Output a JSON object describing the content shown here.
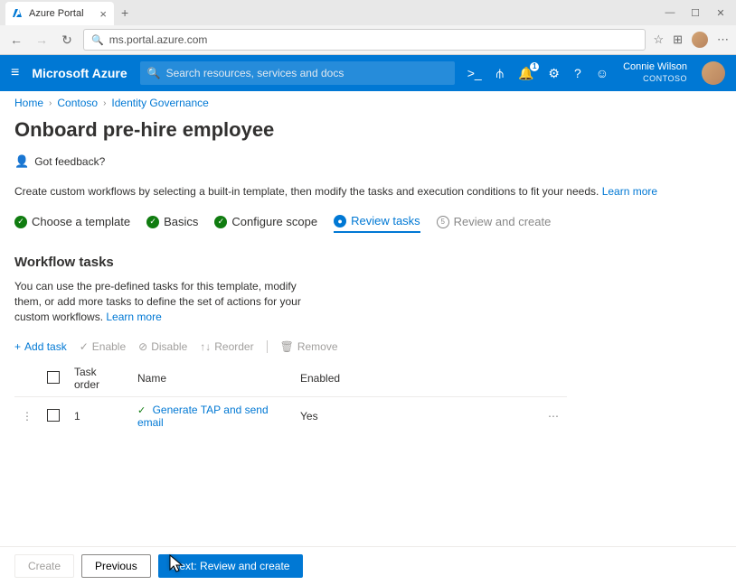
{
  "browser": {
    "tab_title": "Azure Portal",
    "url": "ms.portal.azure.com"
  },
  "azure_bar": {
    "brand": "Microsoft Azure",
    "search_placeholder": "Search resources, services and docs",
    "notif_count": "1",
    "user_name": "Connie Wilson",
    "user_org": "CONTOSO"
  },
  "breadcrumbs": [
    "Home",
    "Contoso",
    "Identity Governance"
  ],
  "page": {
    "title": "Onboard pre-hire employee",
    "feedback": "Got feedback?",
    "description": "Create custom workflows by selecting a built-in template, then modify the tasks and execution conditions to fit your needs.",
    "learn_more": "Learn more"
  },
  "steps": [
    {
      "label": "Choose a template",
      "state": "done"
    },
    {
      "label": "Basics",
      "state": "done"
    },
    {
      "label": "Configure scope",
      "state": "done"
    },
    {
      "label": "Review tasks",
      "state": "current"
    },
    {
      "label": "Review and create",
      "state": "pending",
      "num": "5"
    }
  ],
  "section": {
    "title": "Workflow tasks",
    "description": "You can use the pre-defined tasks for this template, modify them, or add more tasks to define the set of actions for your custom workflows.",
    "learn_more": "Learn more"
  },
  "toolbar": {
    "add": "Add task",
    "enable": "Enable",
    "disable": "Disable",
    "reorder": "Reorder",
    "remove": "Remove"
  },
  "table": {
    "headers": {
      "order": "Task order",
      "name": "Name",
      "enabled": "Enabled"
    },
    "rows": [
      {
        "order": "1",
        "name": "Generate TAP and send email",
        "enabled": "Yes"
      }
    ]
  },
  "footer": {
    "create": "Create",
    "previous": "Previous",
    "next": "Next: Review and create"
  }
}
